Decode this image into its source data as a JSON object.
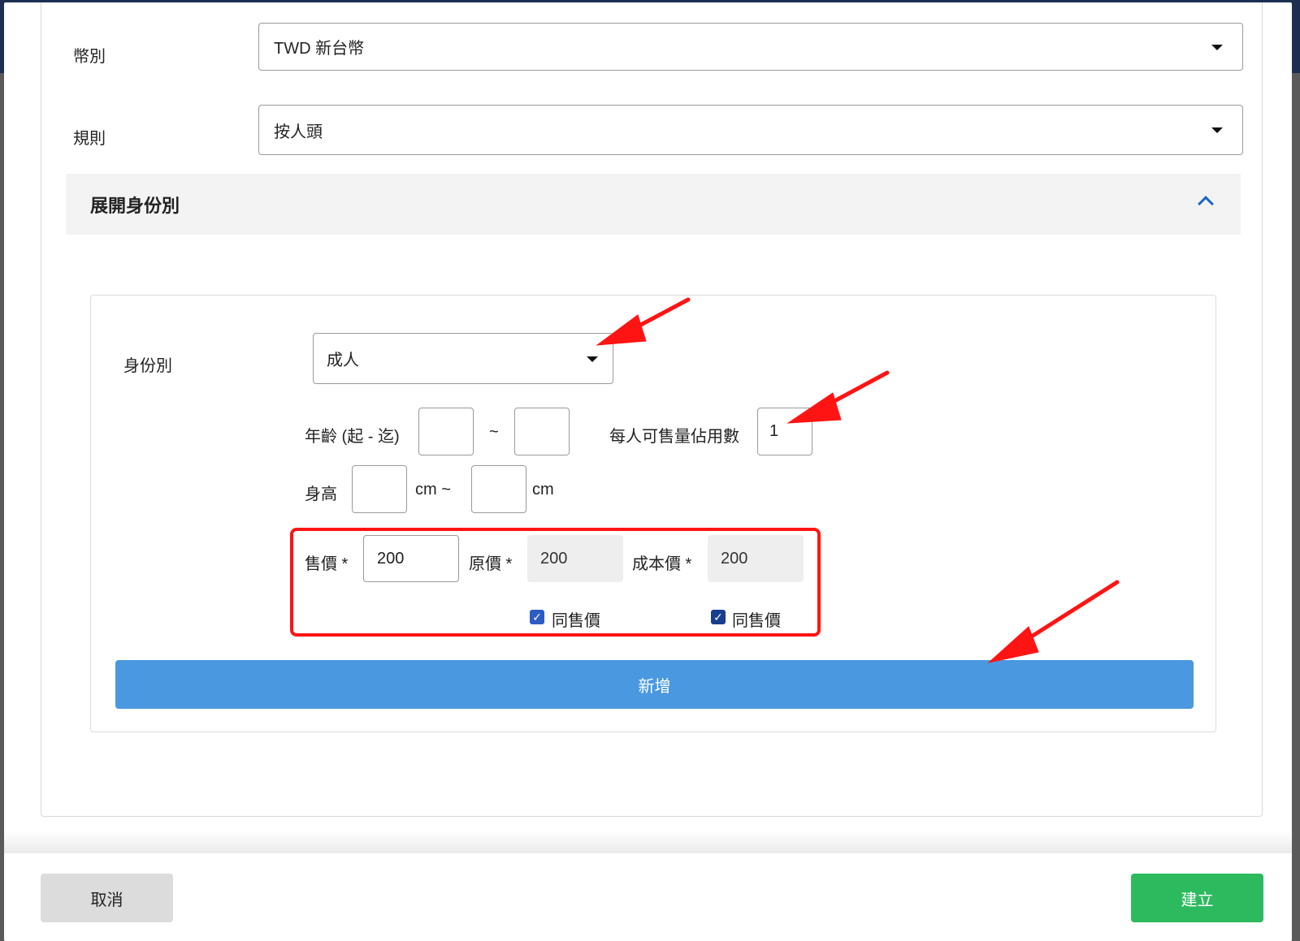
{
  "form": {
    "currency_label": "幣別",
    "currency_value": "TWD 新台幣",
    "rule_label": "規則",
    "rule_value": "按人頭"
  },
  "section": {
    "title": "展開身份別"
  },
  "identity": {
    "type_label": "身份別",
    "type_value": "成人",
    "age_label": "年齡 (起 - 迄)",
    "age_from": "",
    "age_separator": "~",
    "age_to": "",
    "quota_label": "每人可售量佔用數",
    "quota_value": "1",
    "height_label": "身高",
    "height_from": "",
    "height_unit_1": "cm ~",
    "height_to": "",
    "height_unit_2": "cm",
    "sale_price_label": "售價 *",
    "sale_price_value": "200",
    "original_price_label": "原價 *",
    "original_price_value": "200",
    "cost_price_label": "成本價 *",
    "cost_price_value": "200",
    "same_as_sale_1": "同售價",
    "same_as_sale_1_checked": true,
    "same_as_sale_2": "同售價",
    "same_as_sale_2_checked": true,
    "add_button": "新增"
  },
  "footer": {
    "cancel": "取消",
    "create": "建立"
  },
  "colors": {
    "add_button": "#4a98e0",
    "create_button": "#2dba5e",
    "cancel_button": "#dcdcdc",
    "annotation_red": "#ff1414",
    "chevron_blue": "#1a66c9",
    "checkbox_blue": "#2b5cc2"
  }
}
